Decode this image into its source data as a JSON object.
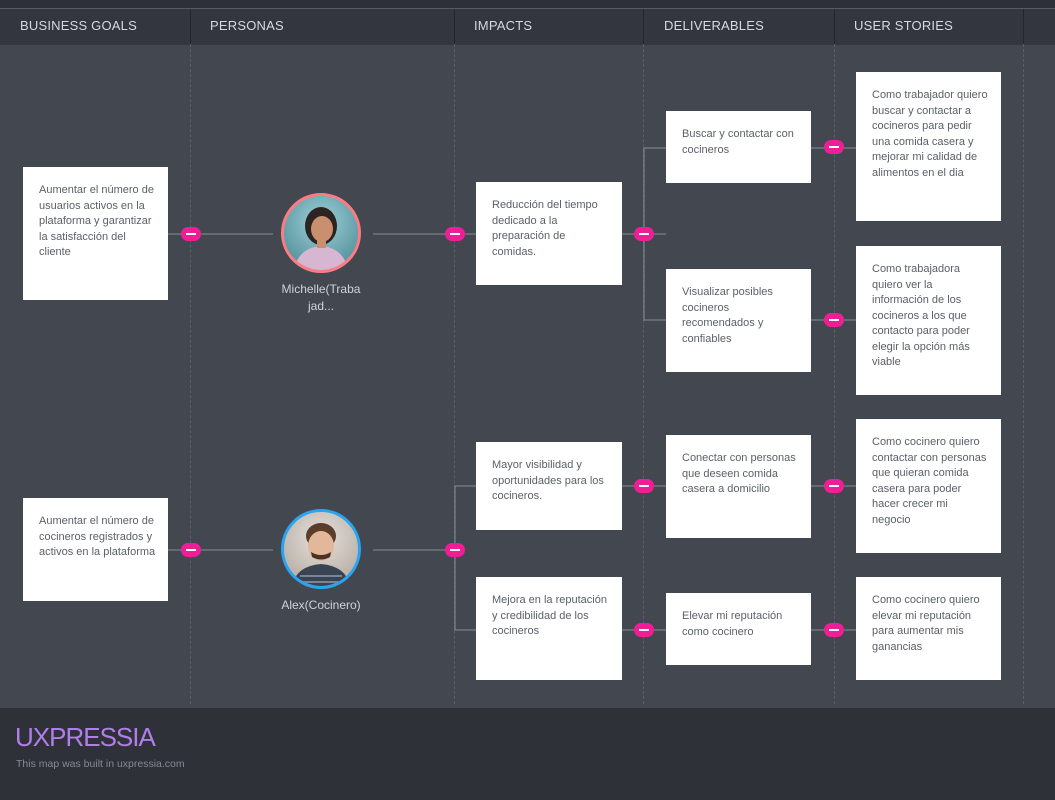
{
  "columns": [
    "BUSINESS GOALS",
    "PERSONAS",
    "IMPACTS",
    "DELIVERABLES",
    "USER STORIES"
  ],
  "goals": [
    "Aumentar el número de usuarios activos en la plataforma y garantizar la satisfacción del cliente",
    "Aumentar el número de cocineros registrados y activos en la plataforma"
  ],
  "personas": [
    "Michelle(Traba jad...",
    "Alex(Cocinero)"
  ],
  "impacts": [
    "Reducción del tiempo dedicado a la preparación de comidas.",
    "Mayor visibilidad y oportunidades para los cocineros.",
    "Mejora en la reputación y credibilidad de los cocineros"
  ],
  "deliverables": [
    "Buscar y contactar con cocineros",
    "Visualizar posibles cocineros recomendados y confiables",
    "Conectar con personas que deseen comida casera a domicilio",
    "Elevar mi reputación como cocinero"
  ],
  "stories": [
    "Como trabajador quiero buscar y contactar a cocineros para pedir una comida casera y mejorar mi calidad de alimentos en el dia",
    "Como trabajadora quiero ver la información de los cocineros a los que contacto para poder elegir la opción más viable",
    "Como cocinero quiero contactar con personas que quieran comida casera para poder hacer crecer mi negocio",
    "Como cocinero quiero elevar mi reputación para aumentar mis ganancias"
  ],
  "footer": {
    "logo": "UXPRESSIA",
    "built_text": "This map was built in uxpressia.com"
  },
  "colors": {
    "accent_pill": "#f01e96",
    "logo": "#b07ee9",
    "persona_border_1": "#ff7b83",
    "persona_border_2": "#2aa3f0"
  }
}
